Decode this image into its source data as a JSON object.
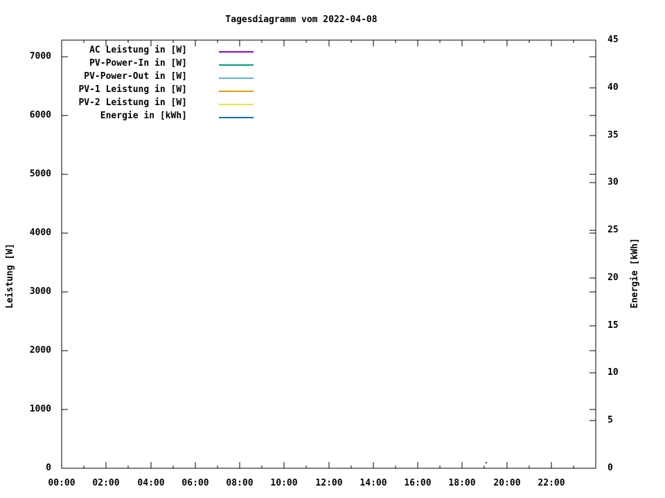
{
  "window": {
    "background": "#ffffff",
    "axis_color": "#000000"
  },
  "chart_data": {
    "type": "line",
    "title": "Tagesdiagramm vom 2022-04-08",
    "grid": false,
    "legend_position": "top-left-inside",
    "x_axis": {
      "label": "",
      "unit": "time",
      "range_hours": [
        0,
        24
      ],
      "major_tick_hours": 2,
      "minor_tick_hours": 1,
      "tick_labels": [
        "00:00",
        "02:00",
        "04:00",
        "06:00",
        "08:00",
        "10:00",
        "12:00",
        "14:00",
        "16:00",
        "18:00",
        "20:00",
        "22:00"
      ]
    },
    "y_axis_left": {
      "label": "Leistung [W]",
      "range": [
        0,
        7283
      ],
      "tick_values": [
        0,
        1000,
        2000,
        3000,
        4000,
        5000,
        6000,
        7000
      ]
    },
    "y_axis_right": {
      "label": "Energie [kWh]",
      "range": [
        0,
        45
      ],
      "tick_values": [
        0,
        5,
        10,
        15,
        20,
        25,
        30,
        35,
        40,
        45
      ]
    },
    "series": [
      {
        "name": "AC Leistung in [W]",
        "color": "#9400d3",
        "axis": "left",
        "points": [
          {
            "time": "19:05",
            "value": 95
          }
        ]
      },
      {
        "name": "PV-Power-In in [W]",
        "color": "#009e73",
        "axis": "left",
        "points": []
      },
      {
        "name": "PV-Power-Out in [W]",
        "color": "#56b4e9",
        "axis": "left",
        "points": []
      },
      {
        "name": "PV-1 Leistung in [W]",
        "color": "#e69f00",
        "axis": "left",
        "points": []
      },
      {
        "name": "PV-2 Leistung in [W]",
        "color": "#f0e442",
        "axis": "left",
        "points": []
      },
      {
        "name": "Energie in [kWh]",
        "color": "#0072b2",
        "axis": "right",
        "points": []
      }
    ]
  }
}
